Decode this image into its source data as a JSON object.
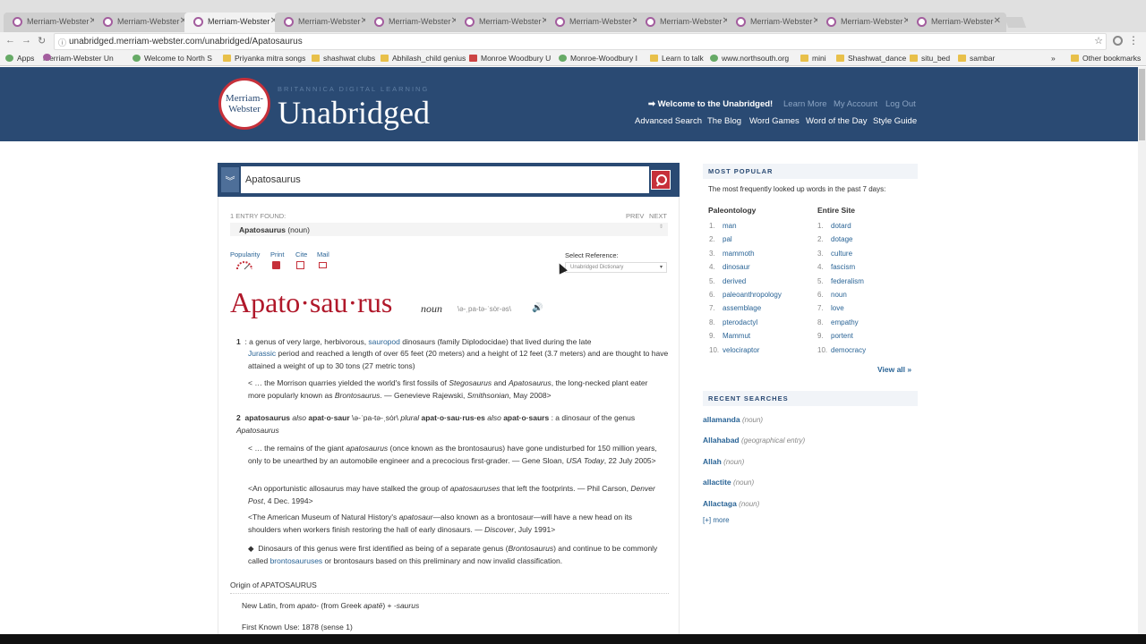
{
  "browser": {
    "tab_title": "Merriam-Webster",
    "url": "unabridged.merriam-webster.com/unabridged/Apatosaurus",
    "bookmarks": [
      "Apps",
      "Merriam-Webster Un",
      "Welcome to North S",
      "Priyanka mitra songs",
      "shashwat clubs",
      "Abhilash_child genius",
      "Monroe Woodbury U",
      "Monroe-Woodbury I",
      "Learn to talk",
      "www.northsouth.org",
      "mini",
      "Shashwat_dance",
      "situ_bed",
      "sambar"
    ],
    "other_bookmarks": "Other bookmarks"
  },
  "header": {
    "logo_line1": "Merriam-",
    "logo_line2": "Webster",
    "tagline": "BRITANNICA DIGITAL LEARNING",
    "title": "Unabridged",
    "welcome": "➡ Welcome to the Unabridged!",
    "learn_more": "Learn More",
    "my_account": "My Account",
    "log_out": "Log Out",
    "nav": [
      "Advanced Search",
      "The Blog",
      "Word Games",
      "Word of the Day",
      "Style Guide"
    ]
  },
  "search": {
    "value": "Apatosaurus"
  },
  "entry": {
    "found": "1 ENTRY FOUND:",
    "prev": "PREV",
    "next": "NEXT",
    "selected_word": "Apatosaurus",
    "selected_pos": "(noun)",
    "tools": [
      "Popularity",
      "Print",
      "Cite",
      "Mail"
    ],
    "select_reference_label": "Select Reference:",
    "select_reference_value": "Unabridged Dictionary",
    "headword": "Apato·sau·rus",
    "pos": "noun",
    "pronunciation": "\\ə-ˌpa-tə-ˈsȯr-əs\\",
    "origin_heading": "Origin of APATOSAURUS",
    "first_known_use": "First Known Use: 1878 (sense 1)"
  },
  "sidebar": {
    "most_popular_heading": "MOST POPULAR",
    "most_popular_desc": "The most frequently looked up words in the past 7 days:",
    "col1_title": "Paleontology",
    "col2_title": "Entire Site",
    "col1": [
      "man",
      "pal",
      "mammoth",
      "dinosaur",
      "derived",
      "paleoanthropology",
      "assemblage",
      "pterodactyl",
      "Mammut",
      "velociraptor"
    ],
    "col2": [
      "dotard",
      "dotage",
      "culture",
      "fascism",
      "federalism",
      "noun",
      "love",
      "empathy",
      "portent",
      "democracy"
    ],
    "view_all": "View all »",
    "recent_heading": "RECENT SEARCHES",
    "recent": [
      {
        "word": "allamanda",
        "type": "(noun)"
      },
      {
        "word": "Allahabad",
        "type": "(geographical entry)"
      },
      {
        "word": "Allah",
        "type": "(noun)"
      },
      {
        "word": "allactite",
        "type": "(noun)"
      },
      {
        "word": "Allactaga",
        "type": "(noun)"
      }
    ],
    "more": "[+] more"
  }
}
